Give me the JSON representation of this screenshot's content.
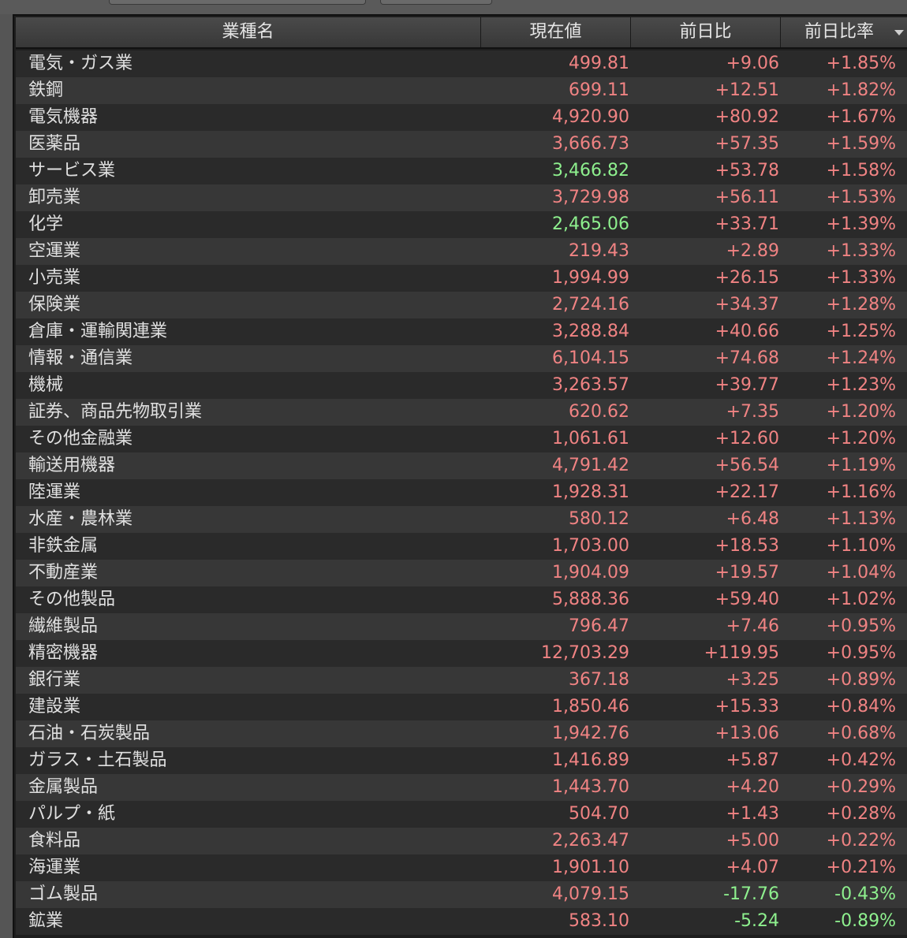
{
  "colors": {
    "up": "#f08383",
    "down": "#8ef08e",
    "name": "#e0e0e0",
    "header_bg": "#404040",
    "row_odd": "#2a2a2a",
    "row_even": "#373737"
  },
  "table": {
    "headers": {
      "name": "業種名",
      "price": "現在値",
      "change": "前日比",
      "change_pct": "前日比率"
    },
    "sort_icon": "chevron-down-icon",
    "rows": [
      {
        "name": "電気・ガス業",
        "price": "499.81",
        "price_dir": "up",
        "change": "+9.06",
        "change_pct": "+1.85%",
        "dir": "up"
      },
      {
        "name": "鉄鋼",
        "price": "699.11",
        "price_dir": "up",
        "change": "+12.51",
        "change_pct": "+1.82%",
        "dir": "up"
      },
      {
        "name": "電気機器",
        "price": "4,920.90",
        "price_dir": "up",
        "change": "+80.92",
        "change_pct": "+1.67%",
        "dir": "up"
      },
      {
        "name": "医薬品",
        "price": "3,666.73",
        "price_dir": "up",
        "change": "+57.35",
        "change_pct": "+1.59%",
        "dir": "up"
      },
      {
        "name": "サービス業",
        "price": "3,466.82",
        "price_dir": "down",
        "change": "+53.78",
        "change_pct": "+1.58%",
        "dir": "up"
      },
      {
        "name": "卸売業",
        "price": "3,729.98",
        "price_dir": "up",
        "change": "+56.11",
        "change_pct": "+1.53%",
        "dir": "up"
      },
      {
        "name": "化学",
        "price": "2,465.06",
        "price_dir": "down",
        "change": "+33.71",
        "change_pct": "+1.39%",
        "dir": "up"
      },
      {
        "name": "空運業",
        "price": "219.43",
        "price_dir": "up",
        "change": "+2.89",
        "change_pct": "+1.33%",
        "dir": "up"
      },
      {
        "name": "小売業",
        "price": "1,994.99",
        "price_dir": "up",
        "change": "+26.15",
        "change_pct": "+1.33%",
        "dir": "up"
      },
      {
        "name": "保険業",
        "price": "2,724.16",
        "price_dir": "up",
        "change": "+34.37",
        "change_pct": "+1.28%",
        "dir": "up"
      },
      {
        "name": "倉庫・運輸関連業",
        "price": "3,288.84",
        "price_dir": "up",
        "change": "+40.66",
        "change_pct": "+1.25%",
        "dir": "up"
      },
      {
        "name": "情報・通信業",
        "price": "6,104.15",
        "price_dir": "up",
        "change": "+74.68",
        "change_pct": "+1.24%",
        "dir": "up"
      },
      {
        "name": "機械",
        "price": "3,263.57",
        "price_dir": "up",
        "change": "+39.77",
        "change_pct": "+1.23%",
        "dir": "up"
      },
      {
        "name": "証券、商品先物取引業",
        "price": "620.62",
        "price_dir": "up",
        "change": "+7.35",
        "change_pct": "+1.20%",
        "dir": "up"
      },
      {
        "name": "その他金融業",
        "price": "1,061.61",
        "price_dir": "up",
        "change": "+12.60",
        "change_pct": "+1.20%",
        "dir": "up"
      },
      {
        "name": "輸送用機器",
        "price": "4,791.42",
        "price_dir": "up",
        "change": "+56.54",
        "change_pct": "+1.19%",
        "dir": "up"
      },
      {
        "name": "陸運業",
        "price": "1,928.31",
        "price_dir": "up",
        "change": "+22.17",
        "change_pct": "+1.16%",
        "dir": "up"
      },
      {
        "name": "水産・農林業",
        "price": "580.12",
        "price_dir": "up",
        "change": "+6.48",
        "change_pct": "+1.13%",
        "dir": "up"
      },
      {
        "name": "非鉄金属",
        "price": "1,703.00",
        "price_dir": "up",
        "change": "+18.53",
        "change_pct": "+1.10%",
        "dir": "up"
      },
      {
        "name": "不動産業",
        "price": "1,904.09",
        "price_dir": "up",
        "change": "+19.57",
        "change_pct": "+1.04%",
        "dir": "up"
      },
      {
        "name": "その他製品",
        "price": "5,888.36",
        "price_dir": "up",
        "change": "+59.40",
        "change_pct": "+1.02%",
        "dir": "up"
      },
      {
        "name": "繊維製品",
        "price": "796.47",
        "price_dir": "up",
        "change": "+7.46",
        "change_pct": "+0.95%",
        "dir": "up"
      },
      {
        "name": "精密機器",
        "price": "12,703.29",
        "price_dir": "up",
        "change": "+119.95",
        "change_pct": "+0.95%",
        "dir": "up"
      },
      {
        "name": "銀行業",
        "price": "367.18",
        "price_dir": "up",
        "change": "+3.25",
        "change_pct": "+0.89%",
        "dir": "up"
      },
      {
        "name": "建設業",
        "price": "1,850.46",
        "price_dir": "up",
        "change": "+15.33",
        "change_pct": "+0.84%",
        "dir": "up"
      },
      {
        "name": "石油・石炭製品",
        "price": "1,942.76",
        "price_dir": "up",
        "change": "+13.06",
        "change_pct": "+0.68%",
        "dir": "up"
      },
      {
        "name": "ガラス・土石製品",
        "price": "1,416.89",
        "price_dir": "up",
        "change": "+5.87",
        "change_pct": "+0.42%",
        "dir": "up"
      },
      {
        "name": "金属製品",
        "price": "1,443.70",
        "price_dir": "up",
        "change": "+4.20",
        "change_pct": "+0.29%",
        "dir": "up"
      },
      {
        "name": "パルプ・紙",
        "price": "504.70",
        "price_dir": "up",
        "change": "+1.43",
        "change_pct": "+0.28%",
        "dir": "up"
      },
      {
        "name": "食料品",
        "price": "2,263.47",
        "price_dir": "up",
        "change": "+5.00",
        "change_pct": "+0.22%",
        "dir": "up"
      },
      {
        "name": "海運業",
        "price": "1,901.10",
        "price_dir": "up",
        "change": "+4.07",
        "change_pct": "+0.21%",
        "dir": "up"
      },
      {
        "name": "ゴム製品",
        "price": "4,079.15",
        "price_dir": "up",
        "change": "-17.76",
        "change_pct": "-0.43%",
        "dir": "down"
      },
      {
        "name": "鉱業",
        "price": "583.10",
        "price_dir": "up",
        "change": "-5.24",
        "change_pct": "-0.89%",
        "dir": "down"
      }
    ]
  }
}
